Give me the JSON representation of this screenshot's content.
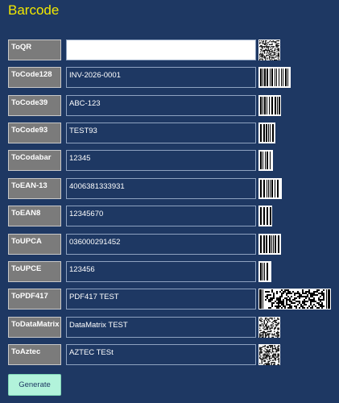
{
  "title": "Barcode",
  "rows": [
    {
      "label": "ToQR",
      "value": "",
      "code_type": "qr"
    },
    {
      "label": "ToCode128",
      "value": "INV-2026-0001",
      "code_type": "code128"
    },
    {
      "label": "ToCode39",
      "value": "ABC-123",
      "code_type": "code39"
    },
    {
      "label": "ToCode93",
      "value": "TEST93",
      "code_type": "code93"
    },
    {
      "label": "ToCodabar",
      "value": "12345",
      "code_type": "codabar"
    },
    {
      "label": "ToEAN-13",
      "value": "4006381333931",
      "code_type": "ean13"
    },
    {
      "label": "ToEAN8",
      "value": "12345670",
      "code_type": "ean8"
    },
    {
      "label": "ToUPCA",
      "value": "036000291452",
      "code_type": "upca"
    },
    {
      "label": "ToUPCE",
      "value": "123456",
      "code_type": "upce"
    },
    {
      "label": "ToPDF417",
      "value": "PDF417 TEST",
      "code_type": "pdf417"
    },
    {
      "label": "ToDataMatrix",
      "value": "DataMatrix TEST",
      "code_type": "datamatrix"
    },
    {
      "label": "ToAztec",
      "value": "AZTEC TESt",
      "code_type": "aztec"
    }
  ],
  "generate_label": "Generate",
  "colors": {
    "background": "#1e3863",
    "title": "#f2e800",
    "button": "#7b7b7b",
    "generate": "#b2f3db"
  }
}
